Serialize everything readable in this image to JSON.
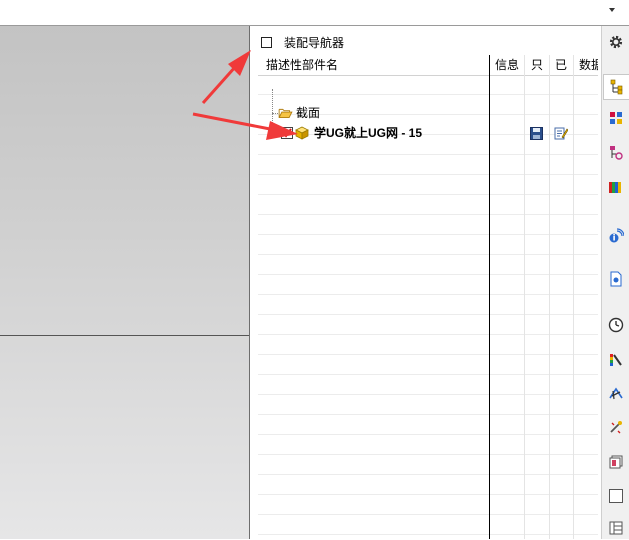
{
  "navigator": {
    "title": "装配导航器",
    "columns": [
      "描述性部件名",
      "信息",
      "只",
      "已",
      "数据"
    ],
    "nodes": [
      {
        "label": "截面",
        "icon": "folder-open-icon"
      },
      {
        "label": "学UG就上UG网 - 15",
        "icon": "assembly-part-icon",
        "checked": true,
        "status_icons": [
          "save-icon",
          "edit-icon"
        ]
      }
    ]
  },
  "toolbar": {
    "items": [
      "gear-icon",
      "assembly-navigator-icon",
      "constraint-navigator-icon",
      "part-navigator-icon",
      "reuse-library-icon",
      "hd3d-tools-icon",
      "web-browser-icon",
      "history-icon",
      "visualization-icon",
      "process-studio-icon",
      "manufacturing-wizard-icon",
      "roles-icon",
      "system-materials-icon",
      "palette-icon"
    ]
  },
  "colors": {
    "arrow": "#f03a3a",
    "check": "#d01010",
    "folder": "#f6c445",
    "part": "#e8b400"
  }
}
